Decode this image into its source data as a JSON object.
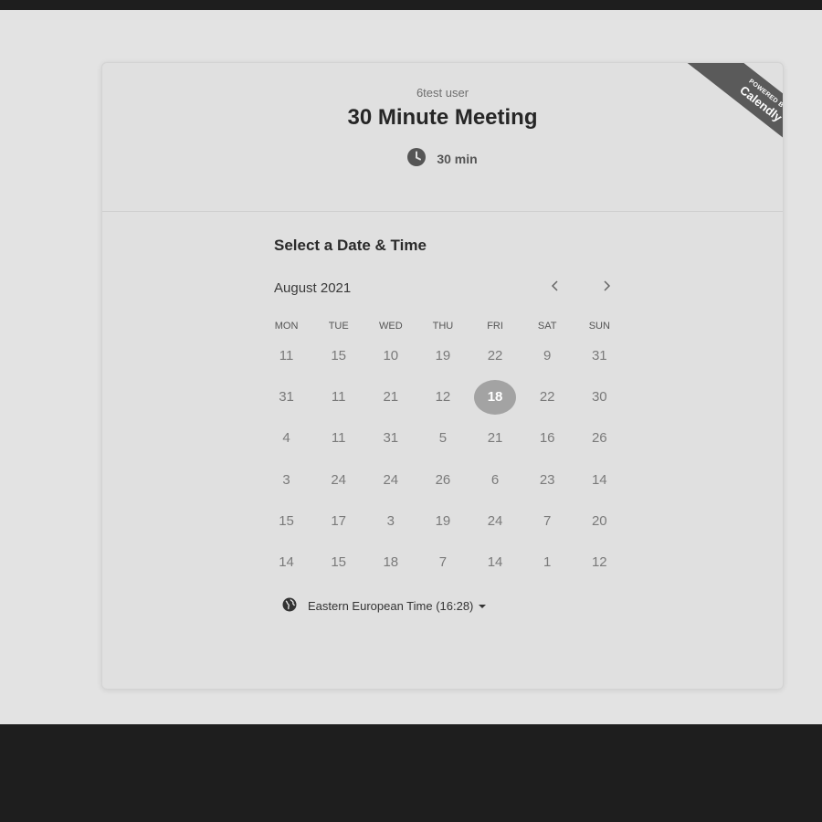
{
  "header": {
    "host_name": "6test user",
    "event_title": "30 Minute Meeting",
    "duration": "30 min",
    "duration_icon": "clock-icon"
  },
  "ribbon": {
    "small_text": "POWERED BY",
    "brand_text": "Calendly"
  },
  "calendar": {
    "section_title": "Select a Date & Time",
    "month_label": "August 2021",
    "prev_icon": "chevron-left-icon",
    "next_icon": "chevron-right-icon",
    "weekdays": [
      "MON",
      "TUE",
      "WED",
      "THU",
      "FRI",
      "SAT",
      "SUN"
    ],
    "rows": [
      [
        "11",
        "15",
        "10",
        "19",
        "22",
        "9",
        "31"
      ],
      [
        "31",
        "11",
        "21",
        "12",
        "18",
        "22",
        "30"
      ],
      [
        "4",
        "11",
        "31",
        "5",
        "21",
        "16",
        "26"
      ],
      [
        "3",
        "24",
        "24",
        "26",
        "6",
        "23",
        "14"
      ],
      [
        "15",
        "17",
        "3",
        "19",
        "24",
        "7",
        "20"
      ],
      [
        "14",
        "15",
        "18",
        "7",
        "14",
        "1",
        "12"
      ]
    ],
    "selected": {
      "row": 1,
      "col": 4
    }
  },
  "timezone": {
    "label": "Eastern European Time (16:28)",
    "icon": "globe-icon"
  },
  "colors": {
    "selected_day_bg": "#a3a3a3",
    "card_bg": "#e0e0e0",
    "page_bg": "#e3e3e3",
    "frame_bg": "#1e1e1e",
    "ribbon_bg": "#5a5a5a"
  }
}
